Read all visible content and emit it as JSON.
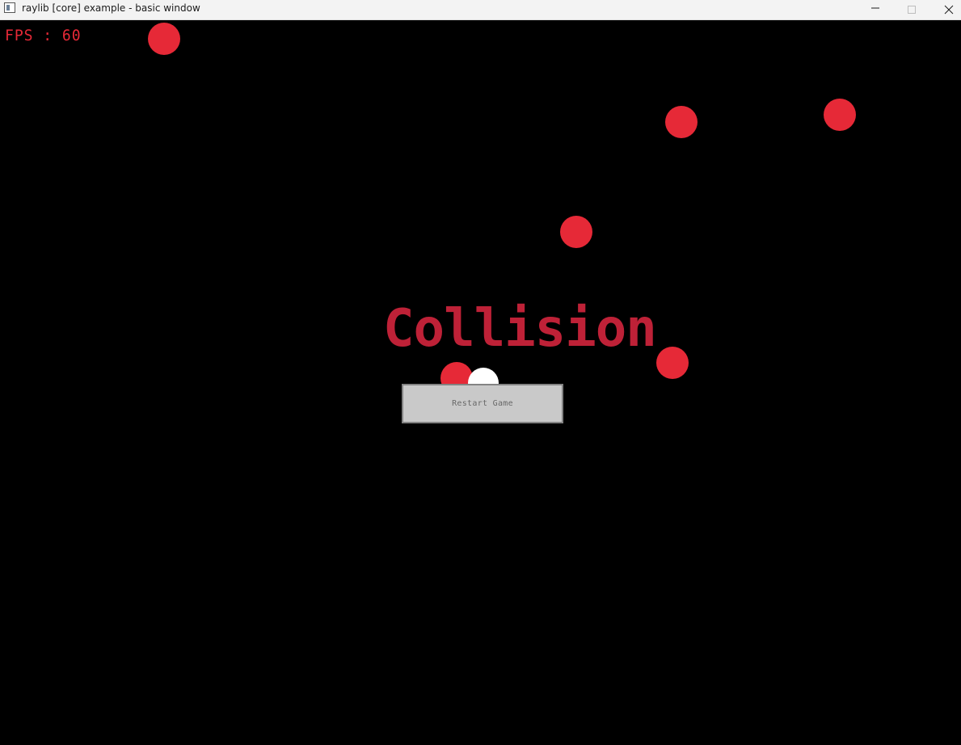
{
  "window": {
    "title": "raylib [core] example - basic window"
  },
  "hud": {
    "fps_text": "FPS : 60"
  },
  "game": {
    "status_text": "Collision",
    "restart_label": "Restart Game",
    "enemy_color": "#e62937",
    "player_color": "#ffffff",
    "status_color": "#be2137",
    "background_color": "#000000"
  }
}
